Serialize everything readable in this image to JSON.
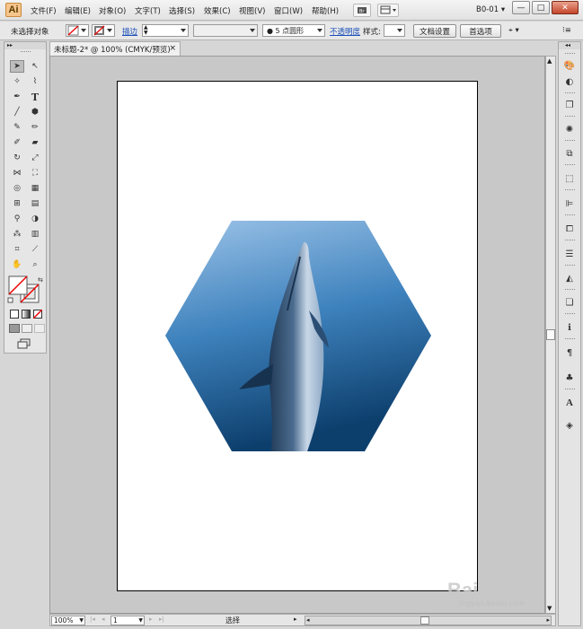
{
  "app": {
    "logo": "Ai",
    "workspace": "B0-01"
  },
  "menu": [
    "文件(F)",
    "编辑(E)",
    "对象(O)",
    "文字(T)",
    "选择(S)",
    "效果(C)",
    "视图(V)",
    "窗口(W)",
    "帮助(H)"
  ],
  "window_controls": {
    "minimize": "—",
    "restore": "□",
    "close": "✕"
  },
  "control_bar": {
    "selection_status": "未选择对象",
    "stroke_label": "描边",
    "brush_value": "5 点圆形",
    "opacity_label": "不透明度",
    "style_label": "样式:",
    "doc_setup_button": "文档设置",
    "preferences_button": "首选项"
  },
  "document": {
    "tab_title": "未标题-2* @ 100% (CMYK/预览)",
    "tab_close": "×"
  },
  "status_bar": {
    "zoom": "100%",
    "page": "1",
    "tool": "选择"
  },
  "colors": {
    "ocean_top": "#9cc3e8",
    "ocean_mid": "#3e82bd",
    "ocean_deep": "#0d3f6d",
    "dolphin_light": "#c9d8e8",
    "dolphin_dark": "#203a57"
  },
  "watermark": {
    "brand": "Bai 经验",
    "url": "jingyan.baidu.com"
  }
}
